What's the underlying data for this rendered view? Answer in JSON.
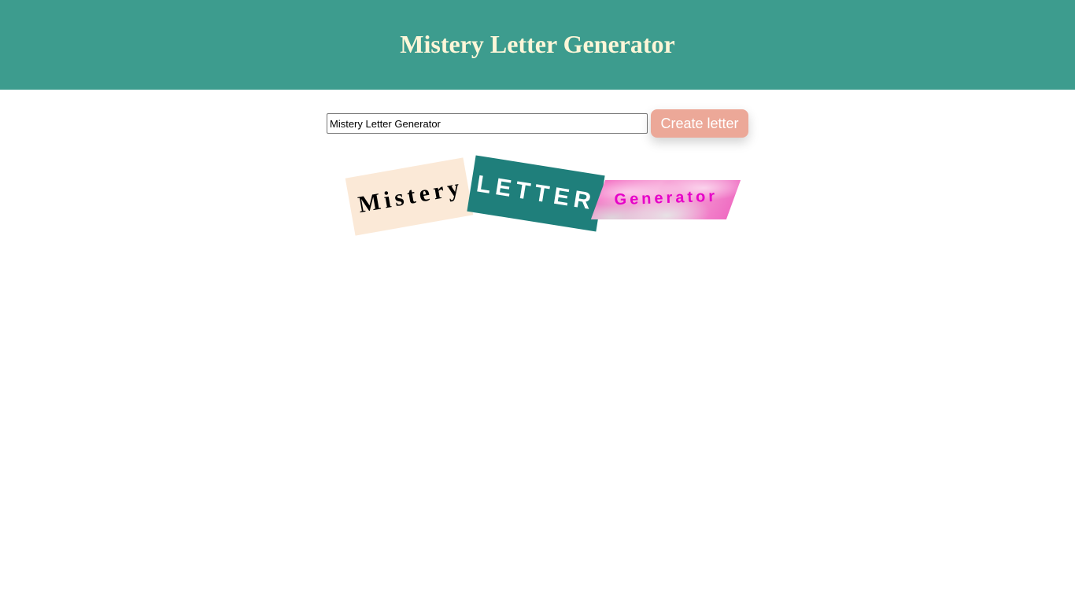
{
  "header": {
    "title": "Mistery Letter Generator"
  },
  "form": {
    "input_value": "Mistery Letter Generator",
    "button_label": "Create letter"
  },
  "letter": {
    "words": [
      "Mistery",
      "LETTER",
      "Generator"
    ]
  },
  "colors": {
    "header_bg": "#3d9c8e",
    "header_text": "#fdf6d8",
    "button_bg": "#eca898",
    "word1_bg": "#fbe9d7",
    "word2_bg": "#1f7f7b",
    "word3_text": "#e600c8"
  }
}
